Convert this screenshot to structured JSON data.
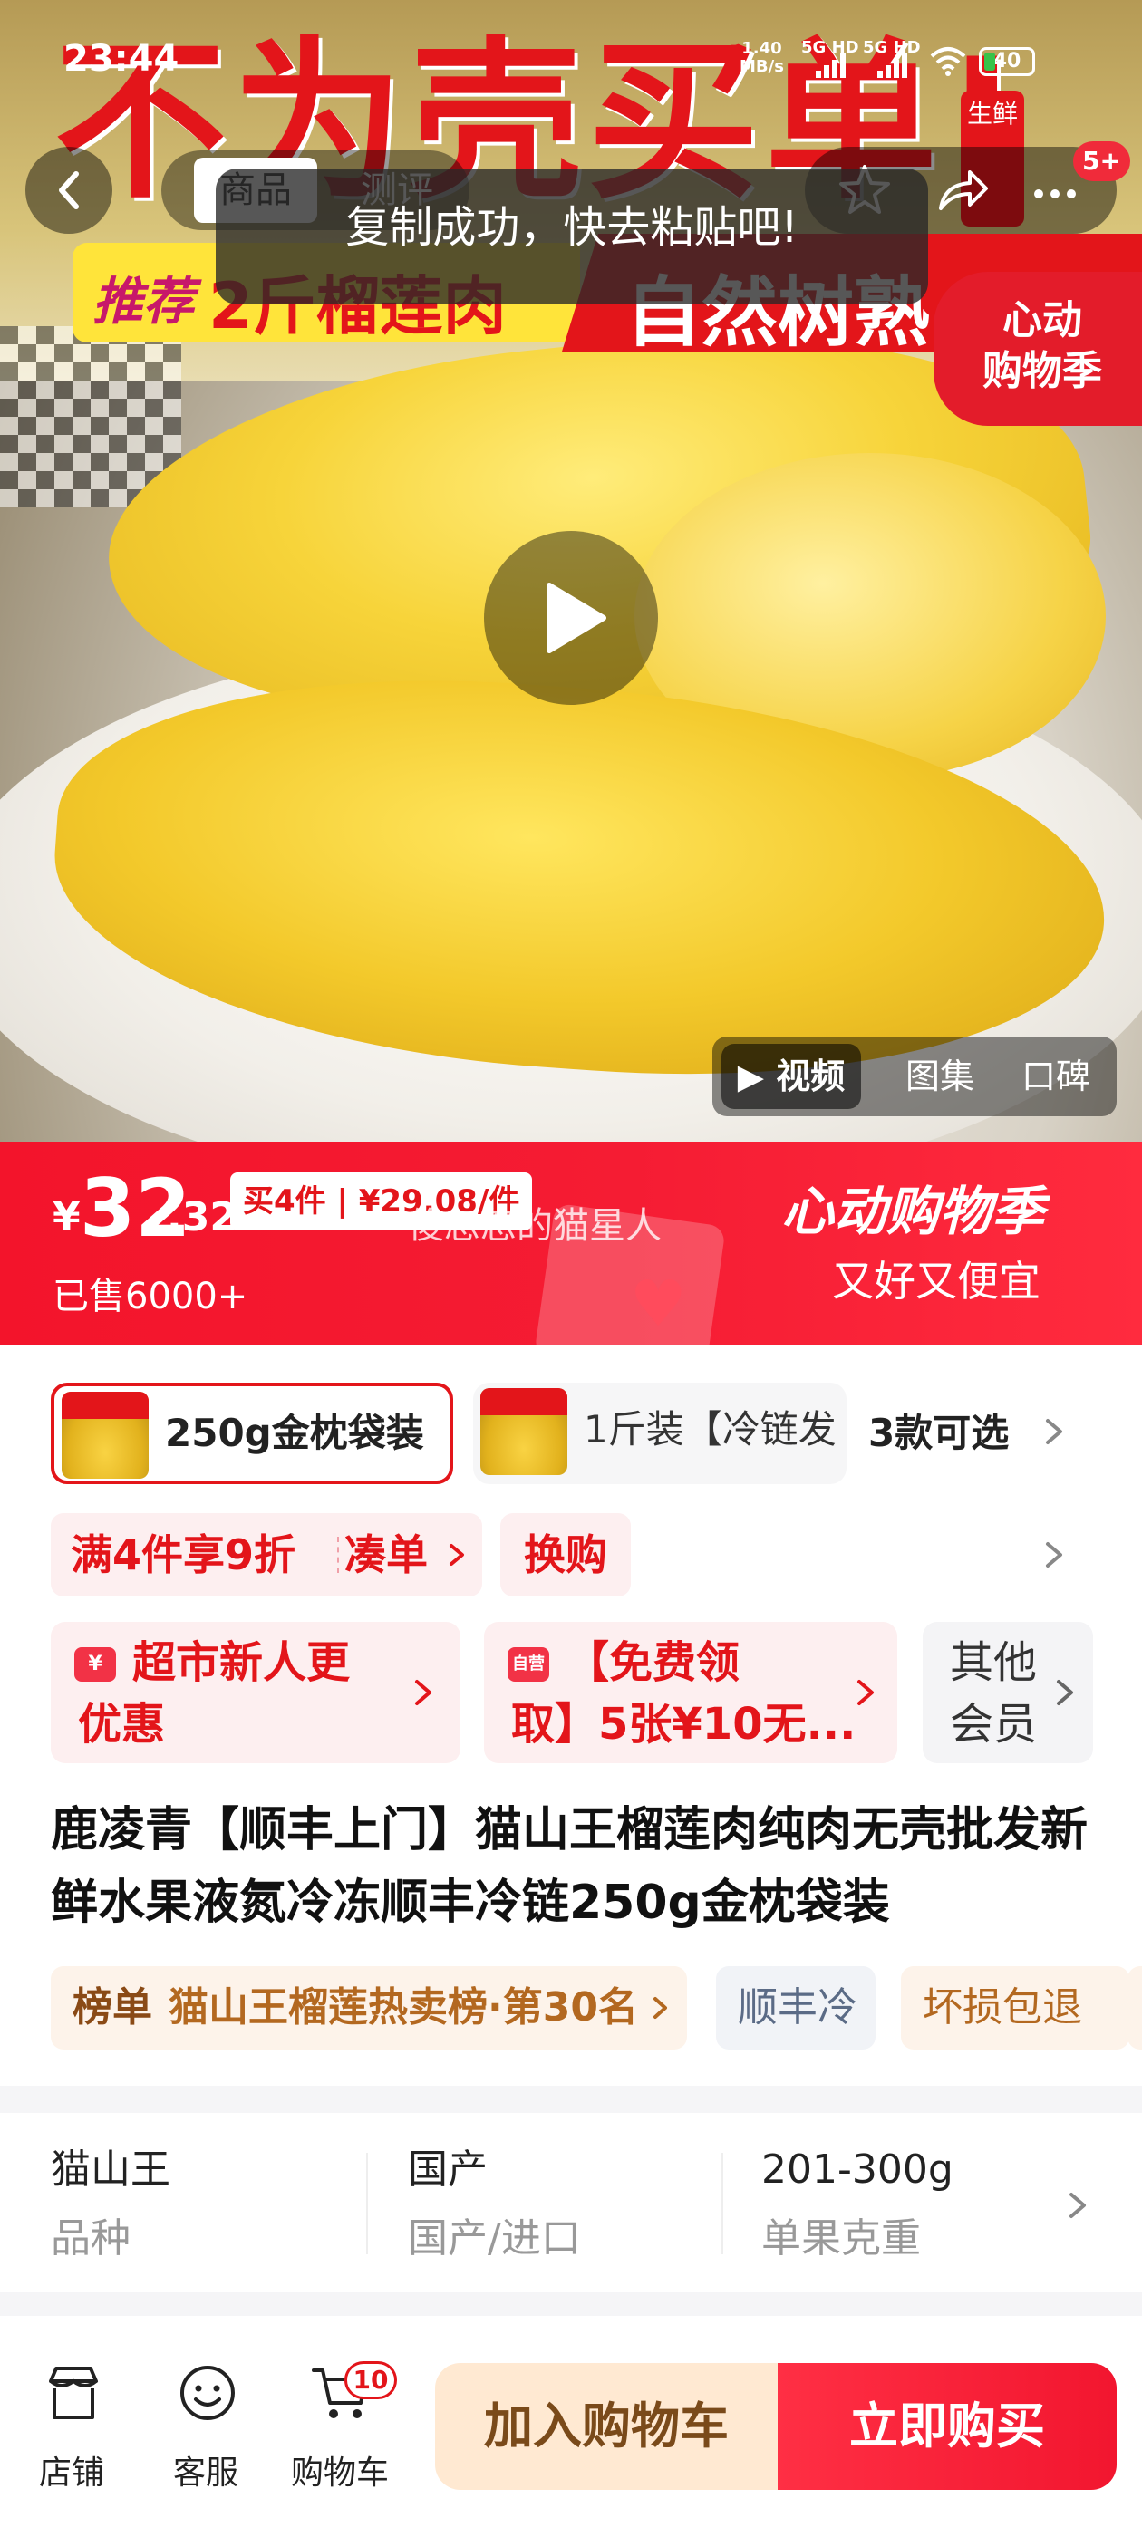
{
  "status_bar": {
    "time": "23:44",
    "net_speed": "1.40",
    "net_unit": "MB/s",
    "signal1": "5G HD",
    "signal2": "5G HD",
    "battery": "40"
  },
  "hero": {
    "banner_title": "不为壳买单!",
    "recommend_tag": "推荐",
    "banner_weight": "2斤榴莲肉",
    "banner_slogan": "自然树熟·家",
    "fresh_badge": "生鲜",
    "promo_badge_line1": "心动",
    "promo_badge_line2": "购物季"
  },
  "nav": {
    "tab_active": "商品",
    "tab_other": "测评",
    "message_count": "5+"
  },
  "toast": "复制成功，快去粘贴吧!",
  "media_tabs": [
    "视频",
    "图集",
    "口碑"
  ],
  "price": {
    "currency": "¥",
    "integer": "32",
    "decimal": ".32",
    "multi_buy": "买4件 | ¥29.08/件",
    "sold": "已售6000+",
    "watermark": "傻忽忽的猫星人",
    "slogan_line1": "心动购物季",
    "slogan_line2": "又好又便宜"
  },
  "sku": {
    "selected": "250g金枕袋装",
    "other": "1斤装【冷链发",
    "more": "3款可选"
  },
  "discount": {
    "offer": "满4件享9折",
    "action": "凑单",
    "exchange": "换购"
  },
  "coupons": [
    {
      "icon": "¥",
      "line1": "超市新人更",
      "line2": "优惠"
    },
    {
      "icon": "自营",
      "line1": "【免费领",
      "line2": "取】5张¥10无..."
    },
    {
      "line1": "其他",
      "line2": "会员"
    }
  ],
  "title": "鹿凌青【顺丰上门】猫山王榴莲肉纯肉无壳批发新鲜水果液氮冷冻顺丰冷链250g金枕袋装",
  "tags": {
    "rank_label": "榜单",
    "rank_text": "猫山王榴莲热卖榜·第30名",
    "shipping": "顺丰冷",
    "damage": "坏损包退"
  },
  "attributes": [
    {
      "value": "猫山王",
      "key": "品种"
    },
    {
      "value": "国产",
      "key": "国产/进口"
    },
    {
      "value": "201-300g",
      "key": "单果克重"
    }
  ],
  "bottom_bar": {
    "shop": "店铺",
    "service": "客服",
    "cart": "购物车",
    "cart_count": "10",
    "add_to_cart": "加入购物车",
    "buy_now": "立即购买"
  },
  "colors": {
    "brand_red": "#e3151a",
    "price_bar_red": "#f51c33",
    "cart_button_bg": "#ffe9d2"
  }
}
